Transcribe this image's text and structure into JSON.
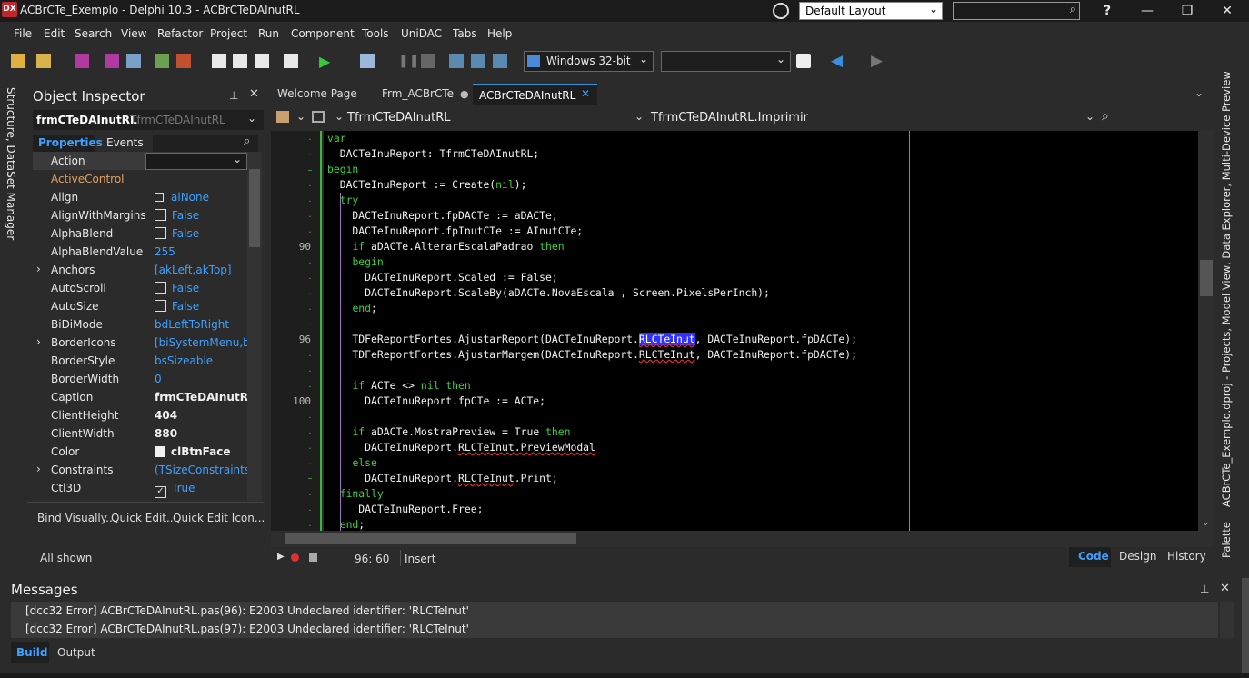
{
  "titlebar": {
    "app_icon": "DX",
    "title": "ACBrCTe_Exemplo - Delphi 10.3 - ACBrCTeDAInutRL",
    "layout_combo": "Default Layout",
    "help": "?",
    "minimize": "—",
    "restore": "❐",
    "close": "✕"
  },
  "menu": {
    "items": [
      "File",
      "Edit",
      "Search",
      "View",
      "Refactor",
      "Project",
      "Run",
      "Component",
      "Tools",
      "UniDAC",
      "Tabs",
      "Help"
    ]
  },
  "toolbar": {
    "platform_combo": "Windows 32-bit",
    "config_combo": ""
  },
  "left_strip": {
    "label": "Structure, DataSet Manager"
  },
  "object_inspector": {
    "title": "Object Inspector",
    "selected_component": "frmCTeDAInutRL",
    "selected_type": "TfrmCTeDAInutRL",
    "tabs": [
      "Properties",
      "Events"
    ],
    "properties": [
      {
        "name": "Action",
        "value": ""
      },
      {
        "name": "ActiveControl",
        "value": ""
      },
      {
        "name": "Align",
        "value": "alNone"
      },
      {
        "name": "AlignWithMargins",
        "value": "False"
      },
      {
        "name": "AlphaBlend",
        "value": "False"
      },
      {
        "name": "AlphaBlendValue",
        "value": "255"
      },
      {
        "name": "Anchors",
        "value": "[akLeft,akTop]"
      },
      {
        "name": "AutoScroll",
        "value": "False"
      },
      {
        "name": "AutoSize",
        "value": "False"
      },
      {
        "name": "BiDiMode",
        "value": "bdLeftToRight"
      },
      {
        "name": "BorderIcons",
        "value": "[biSystemMenu,biM"
      },
      {
        "name": "BorderStyle",
        "value": "bsSizeable"
      },
      {
        "name": "BorderWidth",
        "value": "0"
      },
      {
        "name": "Caption",
        "value": "frmCTeDAInutRL"
      },
      {
        "name": "ClientHeight",
        "value": "404"
      },
      {
        "name": "ClientWidth",
        "value": "880"
      },
      {
        "name": "Color",
        "value": "clBtnFace"
      },
      {
        "name": "Constraints",
        "value": "(TSizeConstraints)"
      },
      {
        "name": "Ctl3D",
        "value": "True"
      }
    ],
    "actions": [
      "Bind Visually...",
      "Quick Edit...",
      "Quick Edit Icon..."
    ],
    "footer": "All shown"
  },
  "editor": {
    "tabs": [
      "Welcome Page",
      "Frm_ACBrCTe",
      "ACBrCTeDAInutRL"
    ],
    "nav_class": "TfrmCTeDAInutRL",
    "nav_method": "TfrmCTeDAInutRL.Imprimir",
    "line_numbers": [
      "90",
      "96",
      "100"
    ],
    "status": {
      "position": "96: 60",
      "mode": "Insert",
      "views": [
        "Code",
        "Design",
        "History"
      ]
    }
  },
  "right_strip": {
    "top_label": "ACBrCTe_Exemplo.dproj - Projects, Model View, Data Explorer, Multi-Device Preview",
    "bottom_label": "Palette"
  },
  "messages": {
    "title": "Messages",
    "lines": [
      "[dcc32 Error] ACBrCTeDAInutRL.pas(96): E2003 Undeclared identifier: 'RLCTeInut'",
      "[dcc32 Error] ACBrCTeDAInutRL.pas(97): E2003 Undeclared identifier: 'RLCTeInut'"
    ],
    "tabs": [
      "Build",
      "Output"
    ]
  },
  "colors": {
    "keyword": "#3cd23c",
    "highlight": "#3030ff",
    "accent": "#3a8fd8",
    "value_blue": "#3ea0ff"
  }
}
